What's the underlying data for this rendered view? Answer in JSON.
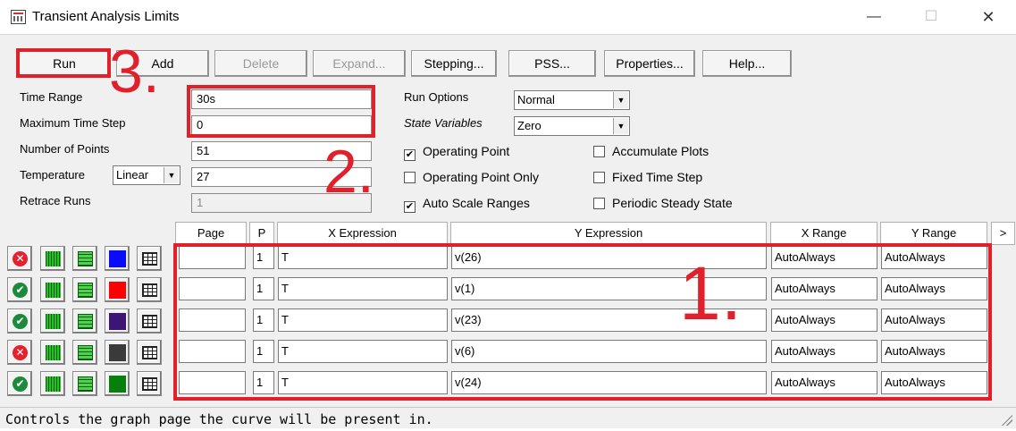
{
  "window": {
    "title": "Transient Analysis Limits",
    "minimize": "—",
    "maximize": "☐",
    "close": "✕"
  },
  "toolbar": {
    "run": "Run",
    "add": "Add",
    "delete": "Delete",
    "expand": "Expand...",
    "stepping": "Stepping...",
    "pss": "PSS...",
    "properties": "Properties...",
    "help": "Help..."
  },
  "limits": {
    "time_range_label": "Time Range",
    "time_range_value": "30s",
    "max_time_step_label": "Maximum Time Step",
    "max_time_step_value": "0",
    "num_points_label": "Number of Points",
    "num_points_value": "51",
    "temperature_label": "Temperature",
    "temperature_mode": "Linear",
    "temperature_value": "27",
    "retrace_runs_label": "Retrace Runs",
    "retrace_runs_value": "1"
  },
  "run_options": {
    "run_options_label": "Run Options",
    "run_options_value": "Normal",
    "state_variables_label": "State Variables",
    "state_variables_value": "Zero"
  },
  "checkboxes": [
    {
      "label": "Operating Point",
      "checked": true
    },
    {
      "label": "Operating Point Only",
      "checked": false
    },
    {
      "label": "Auto Scale Ranges",
      "checked": true
    },
    {
      "label": "Accumulate Plots",
      "checked": false
    },
    {
      "label": "Fixed Time Step",
      "checked": false
    },
    {
      "label": "Periodic Steady State",
      "checked": false
    }
  ],
  "table": {
    "headers": {
      "page": "Page",
      "p": "P",
      "x_expr": "X Expression",
      "y_expr": "Y Expression",
      "x_range": "X Range",
      "y_range": "Y Range",
      "more": ">"
    },
    "rows": [
      {
        "status": "disabled",
        "color": "#0a0aff",
        "page": "",
        "p": "1",
        "x": "T",
        "y": "v(26)",
        "xr": "AutoAlways",
        "yr": "AutoAlways"
      },
      {
        "status": "enabled",
        "color": "#ff0000",
        "page": "",
        "p": "1",
        "x": "T",
        "y": "v(1)",
        "xr": "AutoAlways",
        "yr": "AutoAlways"
      },
      {
        "status": "enabled",
        "color": "#3d1575",
        "page": "",
        "p": "1",
        "x": "T",
        "y": "v(23)",
        "xr": "AutoAlways",
        "yr": "AutoAlways"
      },
      {
        "status": "disabled",
        "color": "#3a3a3a",
        "page": "",
        "p": "1",
        "x": "T",
        "y": "v(6)",
        "xr": "AutoAlways",
        "yr": "AutoAlways"
      },
      {
        "status": "enabled",
        "color": "#07800b",
        "page": "",
        "p": "1",
        "x": "T",
        "y": "v(24)",
        "xr": "AutoAlways",
        "yr": "AutoAlways"
      }
    ]
  },
  "status_bar": "Controls the graph page the curve will be present in.",
  "annotations": {
    "n1": "1.",
    "n2": "2.",
    "n3": "3.",
    "color": "#e0212b"
  }
}
